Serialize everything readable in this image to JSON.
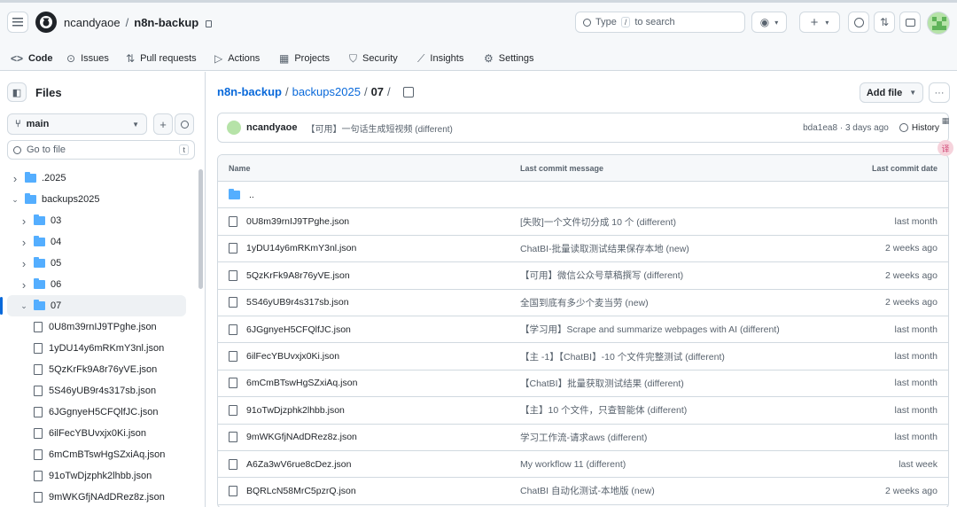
{
  "header": {
    "owner": "ncandyaoe",
    "repo": "n8n-backup",
    "search_label": "Type",
    "search_key": "/",
    "search_suffix": "to search"
  },
  "tabs": [
    {
      "label": "Code",
      "icon": "code-icon",
      "active": true
    },
    {
      "label": "Issues",
      "icon": "issue-opened-icon"
    },
    {
      "label": "Pull requests",
      "icon": "git-pull-request-icon"
    },
    {
      "label": "Actions",
      "icon": "play-icon"
    },
    {
      "label": "Projects",
      "icon": "table-icon"
    },
    {
      "label": "Security",
      "icon": "shield-icon"
    },
    {
      "label": "Insights",
      "icon": "graph-icon"
    },
    {
      "label": "Settings",
      "icon": "gear-icon"
    }
  ],
  "sidebar": {
    "title": "Files",
    "branch": "main",
    "goto_placeholder": "Go to file",
    "goto_key": "t",
    "tree": [
      {
        "label": ".2025",
        "type": "folder",
        "depth": 0,
        "expanded": false
      },
      {
        "label": "backups2025",
        "type": "folder",
        "depth": 0,
        "expanded": true
      },
      {
        "label": "03",
        "type": "folder",
        "depth": 1,
        "expanded": false
      },
      {
        "label": "04",
        "type": "folder",
        "depth": 1,
        "expanded": false
      },
      {
        "label": "05",
        "type": "folder",
        "depth": 1,
        "expanded": false
      },
      {
        "label": "06",
        "type": "folder",
        "depth": 1,
        "expanded": false
      },
      {
        "label": "07",
        "type": "folder",
        "depth": 1,
        "expanded": true,
        "selected": true
      },
      {
        "label": "0U8m39rnIJ9TPghe.json",
        "type": "file",
        "depth": 2
      },
      {
        "label": "1yDU14y6mRKmY3nl.json",
        "type": "file",
        "depth": 2
      },
      {
        "label": "5QzKrFk9A8r76yVE.json",
        "type": "file",
        "depth": 2
      },
      {
        "label": "5S46yUB9r4s317sb.json",
        "type": "file",
        "depth": 2
      },
      {
        "label": "6JGgnyeH5CFQlfJC.json",
        "type": "file",
        "depth": 2
      },
      {
        "label": "6ilFecYBUvxjx0Ki.json",
        "type": "file",
        "depth": 2
      },
      {
        "label": "6mCmBTswHgSZxiAq.json",
        "type": "file",
        "depth": 2
      },
      {
        "label": "91oTwDjzphk2lhbb.json",
        "type": "file",
        "depth": 2
      },
      {
        "label": "9mWKGfjNAdDRez8z.json",
        "type": "file",
        "depth": 2
      }
    ]
  },
  "main": {
    "path_root": "n8n-backup",
    "path_mid": "backups2025",
    "path_current": "07",
    "add_file": "Add file",
    "commit": {
      "author": "ncandyaoe",
      "message": "【可用】一句话生成短视频 (different)",
      "meta": "bda1ea8 · 3 days ago",
      "history": "History"
    },
    "columns": {
      "name": "Name",
      "message": "Last commit message",
      "date": "Last commit date"
    },
    "parent_label": "..",
    "rows": [
      {
        "name": "0U8m39rnIJ9TPghe.json",
        "message": "[失败]一个文件切分成 10 个 (different)",
        "date": "last month"
      },
      {
        "name": "1yDU14y6mRKmY3nl.json",
        "message": "ChatBI-批量读取测试结果保存本地 (new)",
        "date": "2 weeks ago"
      },
      {
        "name": "5QzKrFk9A8r76yVE.json",
        "message": "【可用】微信公众号草稿撰写 (different)",
        "date": "2 weeks ago"
      },
      {
        "name": "5S46yUB9r4s317sb.json",
        "message": "全国到底有多少个麦当劳 (new)",
        "date": "2 weeks ago"
      },
      {
        "name": "6JGgnyeH5CFQlfJC.json",
        "message": "【学习用】Scrape and summarize webpages with AI (different)",
        "date": "last month"
      },
      {
        "name": "6ilFecYBUvxjx0Ki.json",
        "message": "【主 -1】【ChatBI】-10 个文件完整测试 (different)",
        "date": "last month"
      },
      {
        "name": "6mCmBTswHgSZxiAq.json",
        "message": "【ChatBI】批量获取测试结果 (different)",
        "date": "last month"
      },
      {
        "name": "91oTwDjzphk2lhbb.json",
        "message": "【主】10 个文件，只查智能体 (different)",
        "date": "last month"
      },
      {
        "name": "9mWKGfjNAdDRez8z.json",
        "message": "学习工作流-请求aws (different)",
        "date": "last month"
      },
      {
        "name": "A6Za3wV6rue8cDez.json",
        "message": "My workflow 11 (different)",
        "date": "last week"
      },
      {
        "name": "BQRLcN58MrC5pzrQ.json",
        "message": "ChatBI 自动化测试-本地版 (new)",
        "date": "2 weeks ago"
      }
    ]
  },
  "colors": {
    "link": "#0969da",
    "folder": "#54aeff",
    "tab_underline": "#fd8c73"
  }
}
